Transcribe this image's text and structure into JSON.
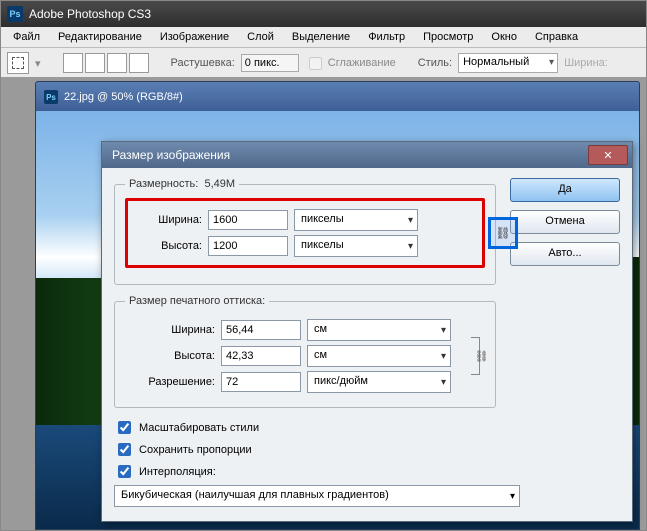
{
  "app": {
    "title": "Adobe Photoshop CS3"
  },
  "menu": {
    "file": "Файл",
    "edit": "Редактирование",
    "image": "Изображение",
    "layer": "Слой",
    "select": "Выделение",
    "filter": "Фильтр",
    "view": "Просмотр",
    "window": "Окно",
    "help": "Справка"
  },
  "options": {
    "feather_label": "Растушевка:",
    "feather_value": "0 пикс.",
    "antialias_label": "Сглаживание",
    "style_label": "Стиль:",
    "style_value": "Нормальный",
    "width_label": "Ширина:"
  },
  "document": {
    "title": "22.jpg @ 50% (RGB/8#)"
  },
  "dialog": {
    "title": "Размер изображения",
    "close": "✕",
    "dimensions_label": "Размерность:",
    "dimensions_value": "5,49M",
    "pixel": {
      "width_label": "Ширина:",
      "width_value": "1600",
      "height_label": "Высота:",
      "height_value": "1200",
      "unit": "пикселы"
    },
    "print": {
      "legend": "Размер печатного оттиска:",
      "width_label": "Ширина:",
      "width_value": "56,44",
      "height_label": "Высота:",
      "height_value": "42,33",
      "unit": "см",
      "res_label": "Разрешение:",
      "res_value": "72",
      "res_unit": "пикс/дюйм"
    },
    "checks": {
      "scale_styles": "Масштабировать стили",
      "constrain": "Сохранить пропорции",
      "resample": "Интерполяция:"
    },
    "interp_value": "Бикубическая (наилучшая для плавных градиентов)",
    "buttons": {
      "ok": "Да",
      "cancel": "Отмена",
      "auto": "Авто..."
    }
  }
}
